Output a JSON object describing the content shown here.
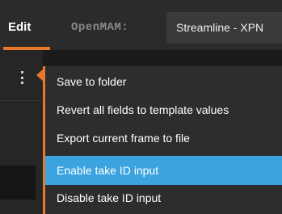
{
  "header": {
    "tab_edit": "Edit",
    "openmam_label": "OpenMAM:",
    "workflow_value": "Streamline - XPN"
  },
  "menu": {
    "items": [
      {
        "label": "Save to folder"
      },
      {
        "label": "Revert all fields to template values"
      },
      {
        "label": "Export current frame to file"
      },
      {
        "label": "Enable take ID input",
        "selected": true
      },
      {
        "label": "Disable take ID input"
      }
    ]
  },
  "colors": {
    "accent": "#e8782a",
    "selection": "#3ba3e0",
    "menu_bg": "#2d2d2d"
  },
  "icons": {
    "more": "kebab-menu-icon"
  }
}
